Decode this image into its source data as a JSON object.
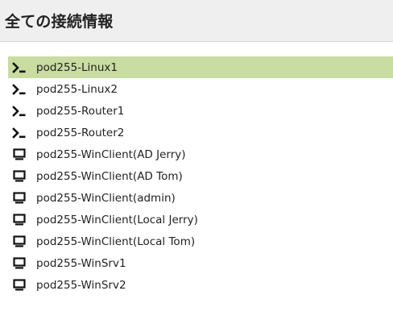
{
  "header": {
    "title": "全ての接続情報"
  },
  "connections": [
    {
      "label": "pod255-Linux1",
      "icon": "terminal-icon",
      "selected": true
    },
    {
      "label": "pod255-Linux2",
      "icon": "terminal-icon",
      "selected": false
    },
    {
      "label": "pod255-Router1",
      "icon": "terminal-icon",
      "selected": false
    },
    {
      "label": "pod255-Router2",
      "icon": "terminal-icon",
      "selected": false
    },
    {
      "label": "pod255-WinClient(AD Jerry)",
      "icon": "desktop-icon",
      "selected": false
    },
    {
      "label": "pod255-WinClient(AD Tom)",
      "icon": "desktop-icon",
      "selected": false
    },
    {
      "label": "pod255-WinClient(admin)",
      "icon": "desktop-icon",
      "selected": false
    },
    {
      "label": "pod255-WinClient(Local Jerry)",
      "icon": "desktop-icon",
      "selected": false
    },
    {
      "label": "pod255-WinClient(Local Tom)",
      "icon": "desktop-icon",
      "selected": false
    },
    {
      "label": "pod255-WinSrv1",
      "icon": "desktop-icon",
      "selected": false
    },
    {
      "label": "pod255-WinSrv2",
      "icon": "desktop-icon",
      "selected": false
    }
  ],
  "colors": {
    "selected_background": "#c9dca1",
    "header_background": "#efefef"
  }
}
